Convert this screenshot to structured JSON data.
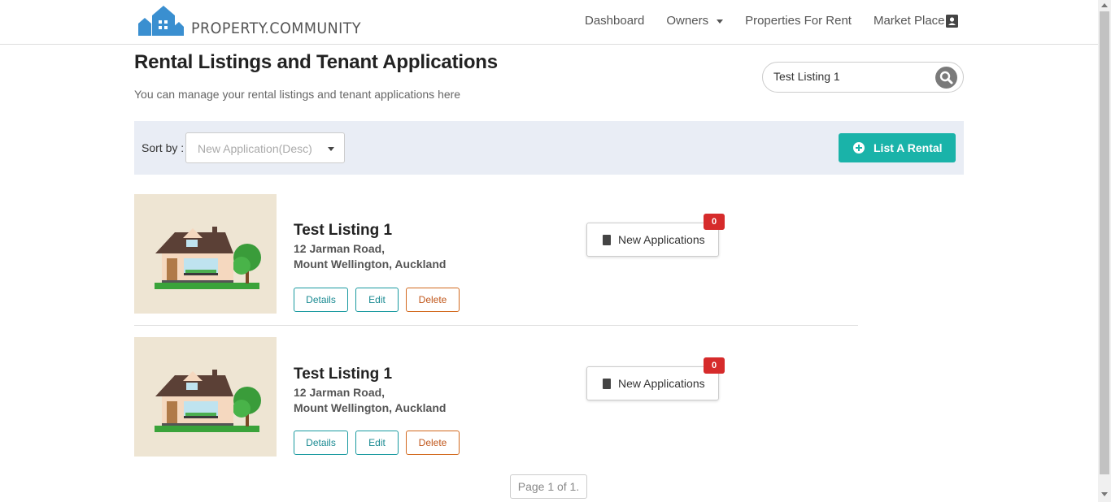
{
  "brand": {
    "name": "PROPERTY.COMMUNITY",
    "accent": "#1ab3a9",
    "logo_color": "#3a8fd0"
  },
  "nav": {
    "items": [
      {
        "label": "Dashboard"
      },
      {
        "label": "Owners"
      },
      {
        "label": "Properties For Rent"
      },
      {
        "label": "Market Place"
      }
    ],
    "profile_icon": "account-box-icon"
  },
  "header": {
    "title": "Rental Listings and Tenant Applications",
    "subtitle": "You can manage your rental listings and tenant applications here"
  },
  "search": {
    "value": "Test Listing 1",
    "icon": "search-icon"
  },
  "sortbar": {
    "label": "Sort by :",
    "selected": "New Application(Desc)",
    "list_button": "List A Rental"
  },
  "listings": [
    {
      "title": "Test Listing 1",
      "address_line1": "12 Jarman Road,",
      "address_line2": "Mount Wellington, Auckland",
      "details_label": "Details",
      "edit_label": "Edit",
      "delete_label": "Delete",
      "applications_label": "New Applications",
      "applications_count": "0"
    },
    {
      "title": "Test Listing 1",
      "address_line1": "12 Jarman Road,",
      "address_line2": "Mount Wellington, Auckland",
      "details_label": "Details",
      "edit_label": "Edit",
      "delete_label": "Delete",
      "applications_label": "New Applications",
      "applications_count": "0"
    }
  ],
  "pagination": {
    "text": "Page 1 of 1."
  }
}
